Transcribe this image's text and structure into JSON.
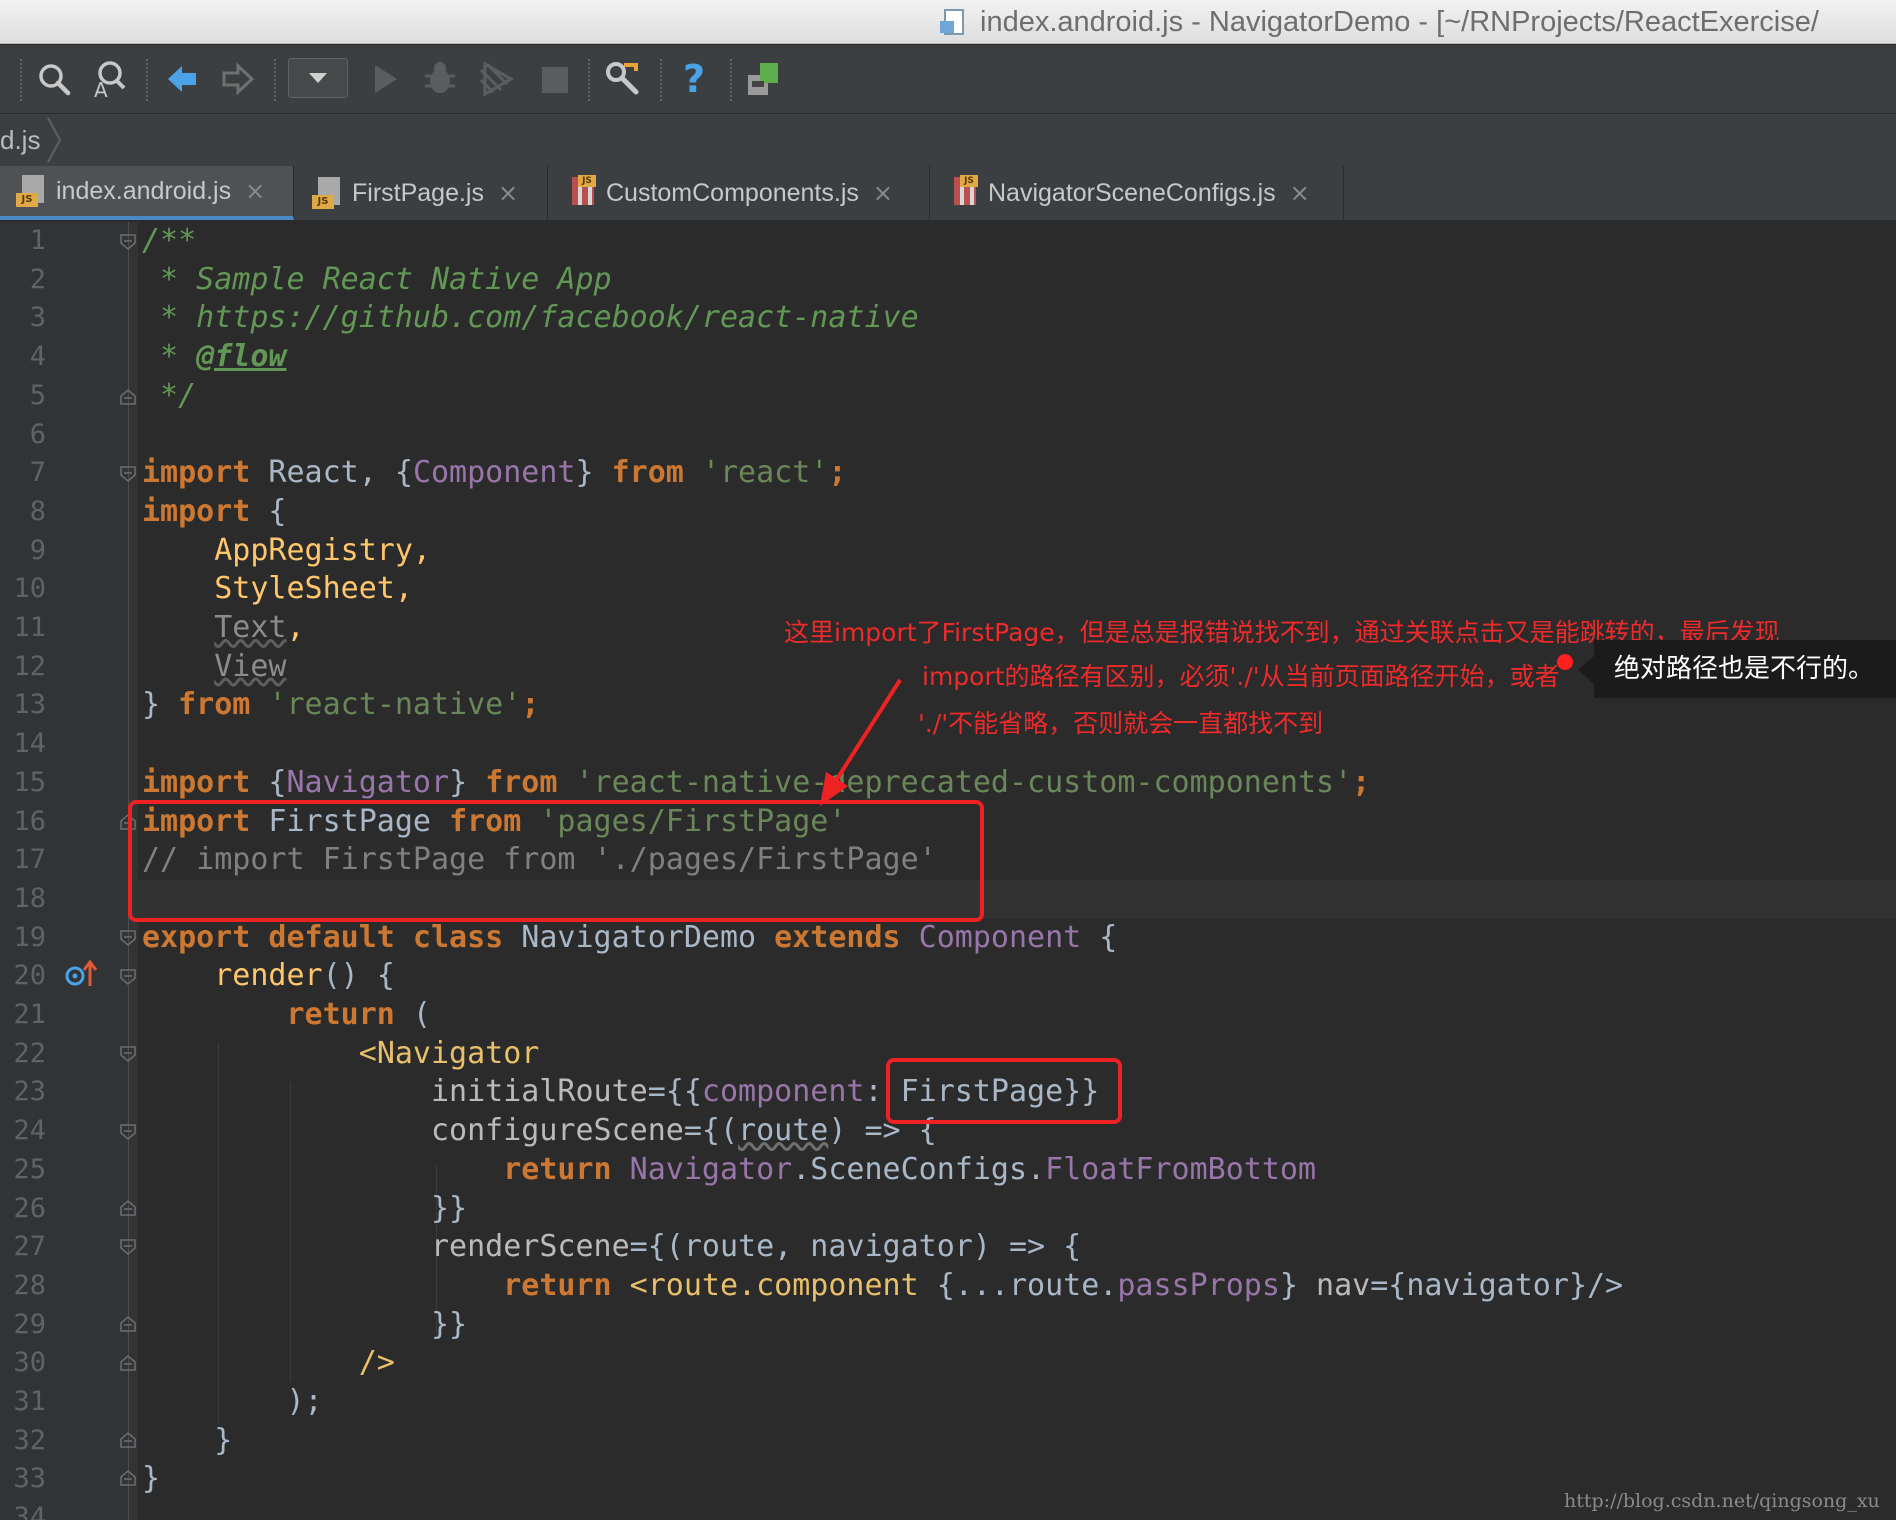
{
  "window": {
    "title": "index.android.js - NavigatorDemo - [~/RNProjects/ReactExercise/"
  },
  "toolbar": {
    "icons": [
      "search-icon",
      "find-usages-icon",
      "back-arrow-icon",
      "forward-arrow-icon",
      "dropdown-icon",
      "run-icon",
      "debug-icon",
      "coverage-icon",
      "stop-icon",
      "settings-icon",
      "help-icon",
      "sdk-manager-icon"
    ],
    "help_label": "?"
  },
  "breadcrumb": {
    "label": "d.js"
  },
  "tabs": [
    {
      "label": "index.android.js",
      "active": true
    },
    {
      "label": "FirstPage.js",
      "active": false
    },
    {
      "label": "CustomComponents.js",
      "active": false
    },
    {
      "label": "NavigatorSceneConfigs.js",
      "active": false
    }
  ],
  "tab_close_glyph": "×",
  "editor": {
    "line_numbers": [
      "1",
      "2",
      "3",
      "4",
      "5",
      "6",
      "7",
      "8",
      "9",
      "10",
      "11",
      "12",
      "13",
      "14",
      "15",
      "16",
      "17",
      "18",
      "19",
      "20",
      "21",
      "22",
      "23",
      "24",
      "25",
      "26",
      "27",
      "28",
      "29",
      "30",
      "31",
      "32",
      "33",
      "34"
    ],
    "code": {
      "l1": "/**",
      "l2": " * Sample React Native App",
      "l3": " * https://github.com/facebook/react-native",
      "l4a": " * ",
      "l4b": "@flow",
      "l5": " */",
      "l7a": "import",
      "l7b": " React, {",
      "l7c": "Component",
      "l7d": "} ",
      "l7e": "from",
      "l7f": " ",
      "l7g": "'react'",
      "l7h": ";",
      "l8a": "import",
      "l8b": " {",
      "l9": "    AppRegistry,",
      "l10": "    StyleSheet,",
      "l11a": "    ",
      "l11b": "Text",
      "l11c": ",",
      "l12a": "    ",
      "l12b": "View",
      "l13a": "} ",
      "l13b": "from",
      "l13c": " ",
      "l13d": "'react-native'",
      "l13e": ";",
      "l15a": "import",
      "l15b": " {",
      "l15c": "Navigator",
      "l15d": "} ",
      "l15e": "from",
      "l15f": " ",
      "l15g": "'react-native-deprecated-custom-components'",
      "l15h": ";",
      "l16a": "import",
      "l16b": " FirstPage ",
      "l16c": "from",
      "l16d": " ",
      "l16e": "'pages/FirstPage'",
      "l17": "// import FirstPage from './pages/FirstPage'",
      "l19a": "export default class",
      "l19b": " NavigatorDemo ",
      "l19c": "extends",
      "l19d": " ",
      "l19e": "Component",
      "l19f": " {",
      "l20a": "    ",
      "l20b": "render",
      "l20c": "() {",
      "l21a": "        ",
      "l21b": "return",
      "l21c": " (",
      "l22a": "            <",
      "l22b": "Navigator",
      "l23a": "                initialRoute",
      "l23b": "={{",
      "l23c": "component",
      "l23d": ": FirstPage}}",
      "l24a": "                configureScene",
      "l24b": "={(",
      "l24c": "route",
      "l24d": ") => {",
      "l25a": "                    ",
      "l25b": "return",
      "l25c": " ",
      "l25d": "Navigator",
      "l25e": ".SceneConfigs.",
      "l25f": "FloatFromBottom",
      "l26": "                }}",
      "l27a": "                renderScene",
      "l27b": "={(route, navigator) => {",
      "l28a": "                    ",
      "l28b": "return",
      "l28c": " <",
      "l28d": "route.component",
      "l28e": " {...route.",
      "l28f": "passProps",
      "l28g": "} ",
      "l28h": "nav",
      "l28i": "={navigator}/>",
      "l29": "                }}",
      "l30": "            />",
      "l31": "        );",
      "l32": "    }",
      "l33": "}"
    }
  },
  "annotations": {
    "line1": "这里import了FirstPage，但是总是报错说找不到，通过关联点击又是能跳转的，最后发现",
    "line2": "import的路径有区别，必须'./'从当前页面路径开始，或者",
    "line3": "'./'不能省略，否则就会一直都找不到",
    "tooltip": "绝对路径也是不行的。"
  },
  "watermark": "http://blog.csdn.net/qingsong_xu",
  "colors": {
    "keyword": "#cc7832",
    "string": "#6a8759",
    "doc_comment": "#629755",
    "annotation_red": "#ee2222",
    "tab_underline": "#4a88c7"
  }
}
